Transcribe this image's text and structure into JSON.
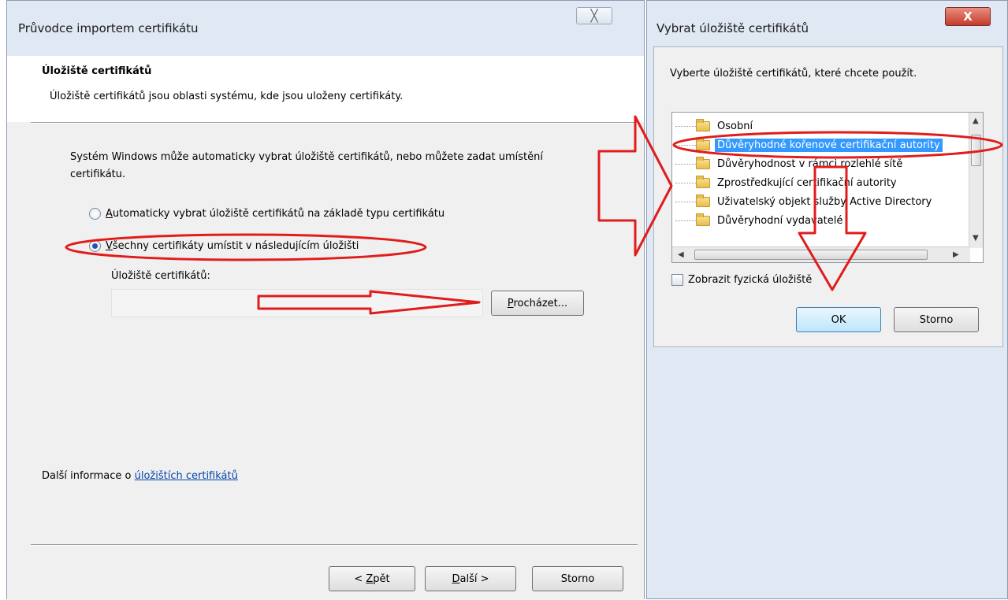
{
  "wizard": {
    "title": "Průvodce importem certifikátu",
    "close_glyph": "╳",
    "section_heading": "Úložiště certifikátů",
    "section_desc": "Úložiště certifikátů jsou oblasti systému, kde jsou uloženy certifikáty.",
    "body_text": "Systém Windows může automaticky vybrat úložiště certifikátů, nebo můžete zadat umístění certifikátu.",
    "radio_auto": {
      "mnemonic": "A",
      "rest": "utomaticky vybrat úložiště certifikátů na základě typu certifikátu"
    },
    "radio_manual": {
      "mnemonic": "V",
      "rest": "šechny certifikáty umístit v následujícím úložišti"
    },
    "store_label": "Úložiště certifikátů:",
    "store_value": "",
    "browse_button": {
      "mnemonic": "P",
      "rest": "rocházet..."
    },
    "info_prefix": "Další informace o ",
    "info_link": "úložištích certifikátů",
    "back_button": {
      "prefix": "< ",
      "mnemonic": "Z",
      "rest": "pět"
    },
    "next_button": {
      "mnemonic": "D",
      "rest": "alší >"
    },
    "cancel_label": "Storno"
  },
  "store_dialog": {
    "title": "Vybrat úložiště certifikátů",
    "close_glyph": "X",
    "prompt": "Vyberte úložiště certifikátů, které chcete použít.",
    "tree_items": [
      "Osobní",
      "Důvěryhodné kořenové certifikační autority",
      "Důvěryhodnost v rámci rozlehlé sítě",
      "Zprostředkující certifikační autority",
      "Uživatelský objekt služby Active Directory",
      "Důvěryhodní vydavatelé"
    ],
    "selected_index": 1,
    "show_physical_label": "Zobrazit fyzická úložiště",
    "ok_label": "OK",
    "cancel_label": "Storno"
  },
  "colors": {
    "annotation_red": "#e01c1c",
    "selection_blue": "#3399ff",
    "link_blue": "#0645ad",
    "title_bar": "#dfe8f3",
    "close_red": "#c43b28"
  }
}
